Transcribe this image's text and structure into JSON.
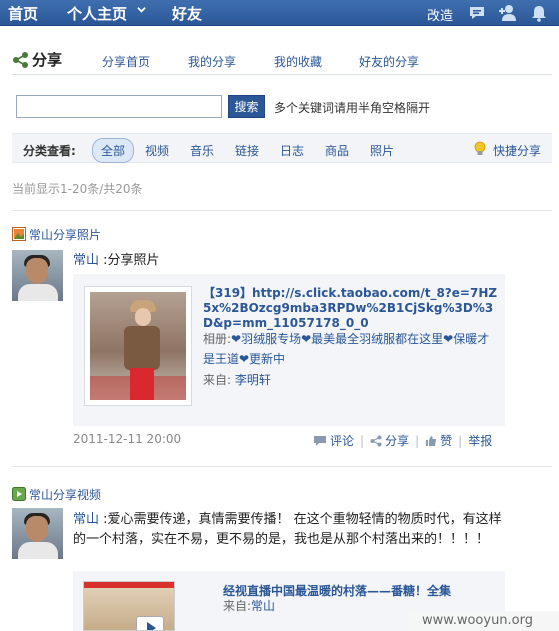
{
  "topbar": {
    "nav": [
      "首页",
      "个人主页",
      "好友"
    ],
    "edit": "改造",
    "icons": [
      "message-icon",
      "add-friend-icon",
      "notification-bell-icon"
    ],
    "bg_color": "#2b5797"
  },
  "share": {
    "title": "分享",
    "subnav": [
      "分享首页",
      "我的分享",
      "我的收藏",
      "好友的分享"
    ]
  },
  "search": {
    "value": "",
    "button": "搜索",
    "hint": "多个关键词请用半角空格隔开"
  },
  "filter": {
    "label": "分类查看:",
    "options": [
      "全部",
      "视频",
      "音乐",
      "链接",
      "日志",
      "商品",
      "照片"
    ],
    "active": "全部",
    "quick_share": "快捷分享"
  },
  "count_text": "当前显示1-20条/共20条",
  "feed": [
    {
      "type_label": "常山分享照片",
      "user": "常山",
      "text": " :分享照片",
      "card": {
        "title": "【319】http://s.click.taobao.com/t_8?e=7HZ5x%2BOzcg9mba3RPDw%2B1CjSkg%3D%3D&p=mm_11057178_0_0",
        "album_label": "相册:",
        "album_text": "❤羽绒服专场❤最美最全羽绒服都在这里❤保暖才是王道❤更新中",
        "from_label": "来自:",
        "from_user": "李明轩"
      },
      "time": "2011-12-11 20:00",
      "actions": [
        "评论",
        "分享",
        "赞",
        "举报"
      ]
    },
    {
      "type_label": "常山分享视频",
      "user": "常山",
      "text": " :爱心需要传递，真情需要传播！ 在这个重物轻情的物质时代，有这样的一个村落，实在不易，更不易的是，我也是从那个村落出来的！！！！",
      "card": {
        "title": "经视直播中国最温暖的村落——番糖！全集",
        "from_label": "来自:",
        "from_user": "常山"
      }
    }
  ],
  "watermark": "www.wooyun.org"
}
